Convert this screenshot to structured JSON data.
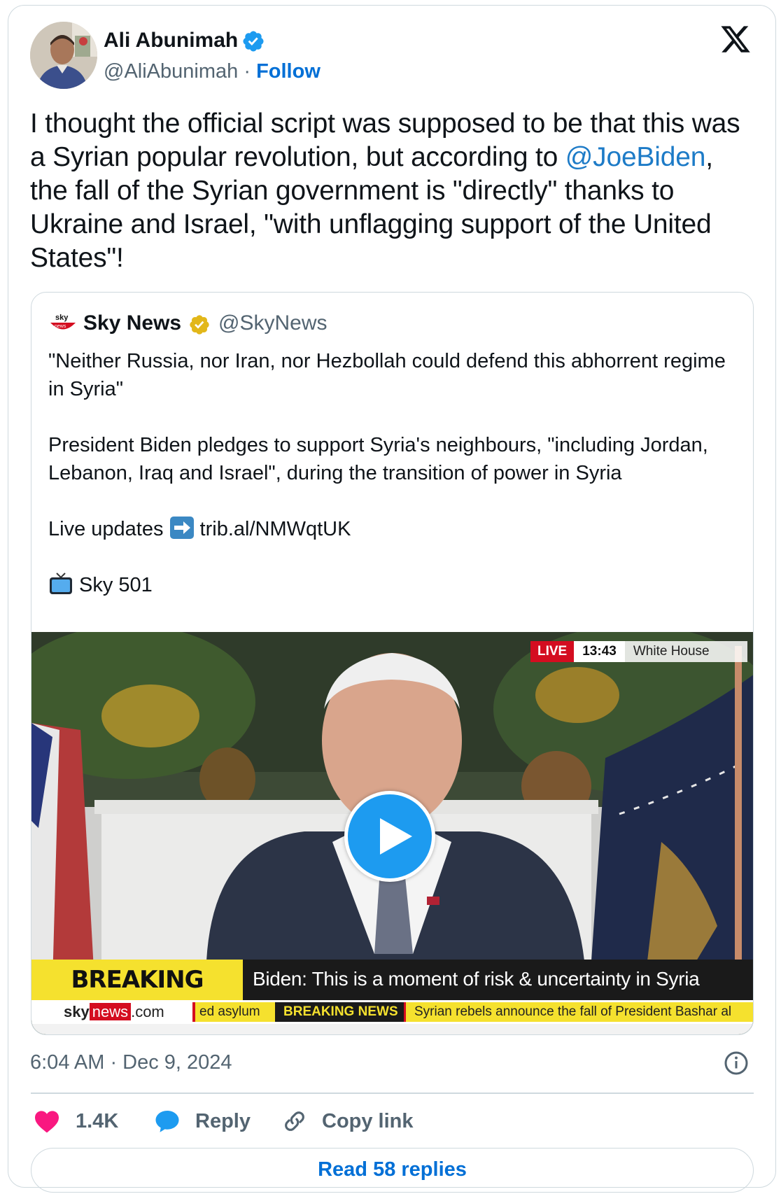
{
  "author": {
    "name": "Ali Abunimah",
    "handle": "@AliAbunimah",
    "separator": "·",
    "follow_label": "Follow",
    "avatar_icon": "user-photo-avatar",
    "verified_icon": "verified-blue-badge"
  },
  "brand_icon": "x-logo-icon",
  "tweet": {
    "text_1": "I thought the official script was supposed to be that this was a Syrian popular revolution, but according to ",
    "mention": "@JoeBiden",
    "text_2": ", the fall of the Syrian government is \"directly\" thanks to Ukraine and Israel, \"with unflagging support of the United States\"!"
  },
  "quote": {
    "name": "Sky News",
    "handle": "@SkyNews",
    "badge_icon": "verified-gold-badge",
    "paragraphs": {
      "p1": "\"Neither Russia, nor Iran, nor Hezbollah could defend this abhorrent regime in Syria\"",
      "p2": "President Biden pledges to support Syria's neighbours, \"including Jordan, Lebanon, Iraq and Israel\", during the transition of power in Syria",
      "p3_prefix": "Live updates",
      "p3_link": "trib.al/NMWqtUK",
      "p4": "Sky 501"
    },
    "video": {
      "live_label": "LIVE",
      "time": "13:43",
      "location": "White House",
      "breaking_label": "BREAKING NEWS",
      "headline": "Biden: This is a moment of risk & uncertainty in Syria",
      "ticker_brand_a": "sky",
      "ticker_brand_b": "news",
      "ticker_brand_c": ".com",
      "ticker_1": "ed asylum",
      "ticker_2": "BREAKING NEWS",
      "ticker_3": "Syrian rebels announce the fall of President Bashar al"
    }
  },
  "meta": {
    "timestamp": "6:04 AM · Dec 9, 2024"
  },
  "actions": {
    "like_count": "1.4K",
    "reply_label": "Reply",
    "copy_label": "Copy link"
  },
  "read_replies": "Read 58 replies",
  "colors": {
    "accent_blue": "#1d9bf0",
    "link_blue": "#006fd6",
    "like_pink": "#f91880",
    "sky_red": "#d40d20",
    "breaking_yellow": "#f5e12e"
  }
}
